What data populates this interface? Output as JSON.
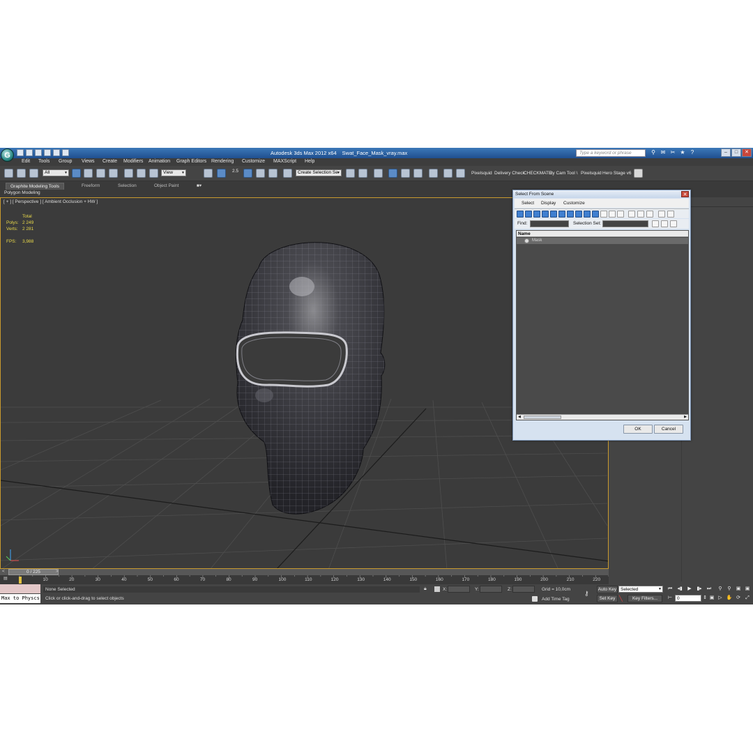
{
  "window": {
    "app_title": "Autodesk 3ds Max  2012 x64",
    "file_name": "Swat_Face_Mask_vray.max",
    "help_search_placeholder": "Type a keyword or phrase",
    "logo_letter": "G"
  },
  "menu": [
    "Edit",
    "Tools",
    "Group",
    "Views",
    "Create",
    "Modifiers",
    "Animation",
    "Graph Editors",
    "Rendering",
    "Customize",
    "MAXScript",
    "Help"
  ],
  "toolbar": {
    "selection_filter": "All",
    "ref_coord": "View",
    "snap_value": "2.5",
    "named_selection": "Create Selection Se",
    "plugins": [
      "Pixelsquid",
      "Delivery Check",
      "CHECKMATE",
      "uty Cam Tool \\",
      "Pixelsquid",
      "Hero Stage v6"
    ]
  },
  "ribbon": {
    "tabs": [
      "Graphite Modeling Tools",
      "Freeform",
      "Selection",
      "Object Paint"
    ],
    "active_tab": "Graphite Modeling Tools",
    "sub_label": "Polygon Modeling"
  },
  "viewport": {
    "label": "[ + ] [ Perspective ] [ Ambient Occlusion + HW ]",
    "stats_header": "Total",
    "polys_label": "Polys:",
    "polys_value": "2 249",
    "verts_label": "Verts:",
    "verts_value": "2 281",
    "fps_label": "FPS:",
    "fps_value": "3,988"
  },
  "dialog": {
    "title": "Select From Scene",
    "menu": [
      "Select",
      "Display",
      "Customize"
    ],
    "find_label": "Find:",
    "selection_set_label": "Selection Set:",
    "list_header": "Name",
    "items": [
      {
        "name": "Mask"
      }
    ],
    "ok_label": "OK",
    "cancel_label": "Cancel"
  },
  "timeline": {
    "frame_counter": "0 / 225",
    "left_arrow": "<",
    "right_arrow": ">",
    "ticks": [
      10,
      20,
      30,
      40,
      50,
      60,
      70,
      80,
      90,
      100,
      110,
      120,
      130,
      140,
      150,
      160,
      170,
      180,
      190,
      200,
      210,
      220
    ]
  },
  "status": {
    "maxscript_label": "Max to Physcs",
    "selection_status": "None Selected",
    "prompt": "Click or click-and-drag to select objects",
    "x_label": "X:",
    "y_label": "Y:",
    "z_label": "Z:",
    "grid": "Grid = 10,0cm",
    "add_time_tag": "Add Time Tag",
    "auto_key": "Auto Key",
    "set_key": "Set Key",
    "key_mode": "Selected",
    "key_filters": "Key Filters...",
    "current_frame": "0"
  }
}
